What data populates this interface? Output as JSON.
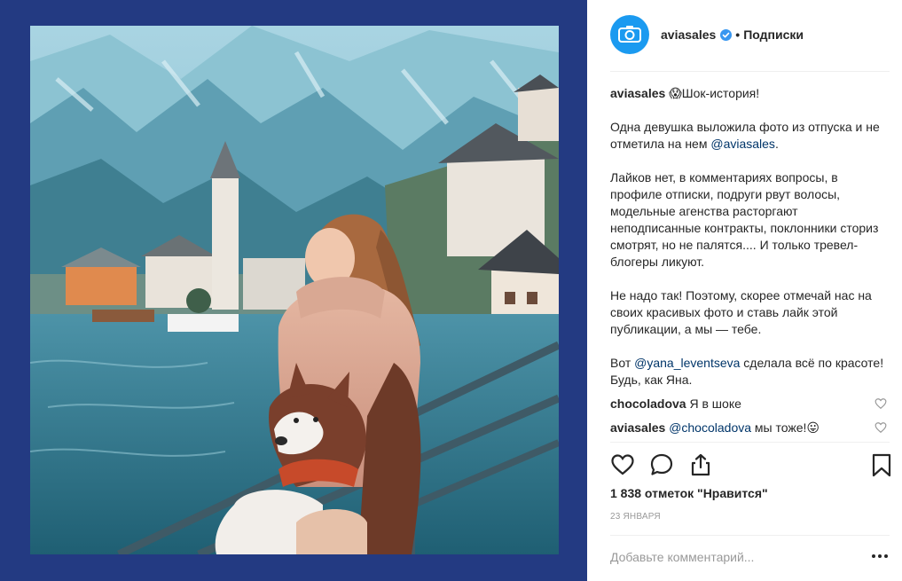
{
  "header": {
    "username": "aviasales",
    "separator": "•",
    "follow_label": "Подписки"
  },
  "caption": {
    "username": "aviasales",
    "emoji": "😱",
    "line1": "Шок-история!",
    "p2_text": "Одна девушка выложила фото из отпуска и не отметила на нем ",
    "p2_mention": "@aviasales",
    "p2_end": ".",
    "p3": "Лайков нет, в комментариях вопросы, в профиле отписки, подруги рвут волосы, модельные агенства расторгают неподписанные контракты, поклонники сториз смотрят, но не палятся.... И только тревел-блогеры ликуют.",
    "p4": "Не надо так! Поэтому, скорее отмечай нас на своих красивых фото и ставь лайк этой публикации, а мы — тебе.",
    "p5_start": "Вот ",
    "p5_mention": "@yana_leventseva",
    "p5_end": " сделала всё по красоте! Будь, как Яна."
  },
  "comments": [
    {
      "username": "chocoladova",
      "text": "Я в шоке"
    },
    {
      "username": "aviasales",
      "mention": "@chocoladova",
      "text": "мы тоже!",
      "emoji": "😛"
    },
    {
      "username": "",
      "text": ""
    }
  ],
  "actions": {
    "like_icon": "heart-outline-icon",
    "comment_icon": "comment-bubble-icon",
    "share_icon": "share-icon",
    "save_icon": "bookmark-icon"
  },
  "likes_text": "1 838 отметок \"Нравится\"",
  "date_text": "23 ЯНВАРЯ",
  "add_comment": {
    "placeholder": "Добавьте комментарий..."
  },
  "colors": {
    "frame": "#233a82",
    "avatar": "#1b9af0",
    "link": "#003569",
    "muted": "#999999"
  }
}
